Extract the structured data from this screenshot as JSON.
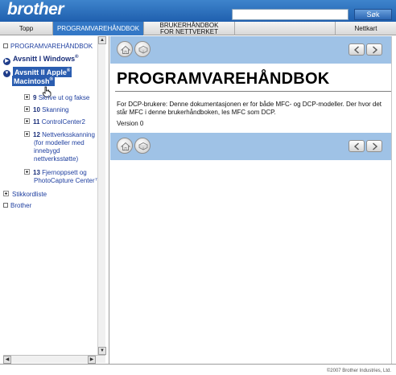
{
  "header": {
    "logo_text": "brother",
    "search_placeholder": "",
    "search_button_label": "Søk",
    "tabs": [
      {
        "label": "Topp"
      },
      {
        "label": "PROGRAMVAREHÅNDBOK",
        "active": true
      },
      {
        "label_line1": "BRUKERHÅNDBOK",
        "label_line2": "FOR NETTVERKET"
      },
      {
        "label": "Nettkart"
      }
    ]
  },
  "sidebar": {
    "items": [
      {
        "label": "PROGRAMVAREHÅNDBOK"
      },
      {
        "label": "Avsnitt I Windows",
        "sup": "®"
      },
      {
        "label_line1": "Avsnitt II Apple",
        "sup1": "®",
        "label_line2": "Macintosh",
        "sup2": "®"
      },
      {
        "number": "9",
        "label": "Skrive ut og fakse"
      },
      {
        "number": "10",
        "label": "Skanning"
      },
      {
        "number": "11",
        "label": "ControlCenter2"
      },
      {
        "number": "12",
        "label": "Nettverksskanning (for modeller med innebygd nettverksstøtte)"
      },
      {
        "number": "13",
        "label": "Fjernoppsett og PhotoCapture Center™"
      },
      {
        "label": "Stikkordliste"
      },
      {
        "label": "Brother"
      }
    ]
  },
  "main": {
    "title": "PROGRAMVAREHÅNDBOK",
    "body": "For DCP-brukere: Denne dokumentasjonen er for både MFC- og DCP-modeller. Der hvor det står MFC i denne brukerhåndboken, les MFC som DCP.",
    "version": "Version 0"
  },
  "footer": {
    "copyright": "©2007 Brother Industries, Ltd."
  },
  "colors": {
    "brand_blue": "#2f6fbe",
    "toolbar_blue": "#9fc2e6",
    "selected_blue": "#2a5db0",
    "link_blue": "#2040a0"
  }
}
